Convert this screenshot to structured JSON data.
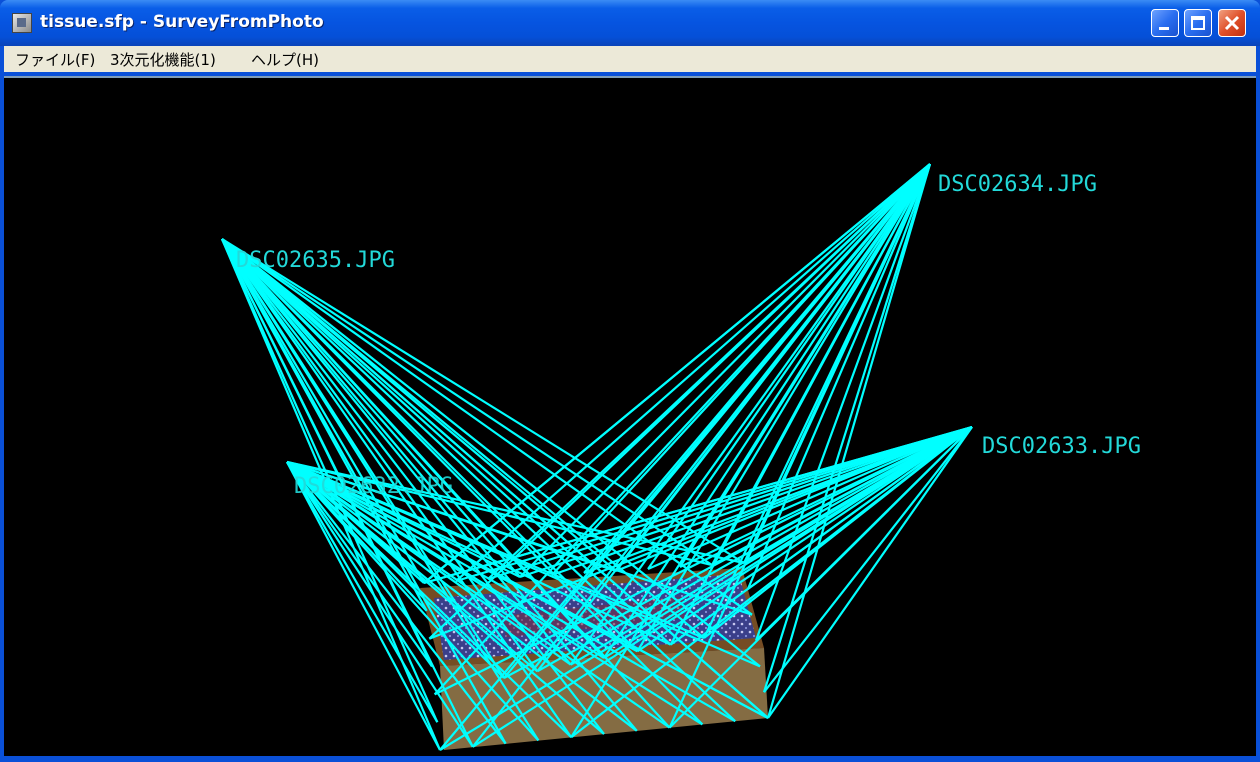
{
  "window": {
    "title": "tissue.sfp - SurveyFromPhoto",
    "icon": "app-icon",
    "controls": {
      "minimize": "minimize-icon",
      "maximize": "maximize-icon",
      "close": "close-icon"
    }
  },
  "menu": {
    "items": [
      {
        "label": "ファイル(F)"
      },
      {
        "label": "3次元化機能(1)"
      },
      {
        "label": "ヘルプ(H)"
      }
    ]
  },
  "viewport": {
    "background": "#000000",
    "ray_color": "#00ffff",
    "label_color": "#23d9d9",
    "cameras": [
      {
        "name": "DSC02634.JPG"
      },
      {
        "name": "DSC02635.JPG"
      },
      {
        "name": "DSC02633.JPG"
      },
      {
        "name": "DSC02632.JPG"
      }
    ]
  }
}
